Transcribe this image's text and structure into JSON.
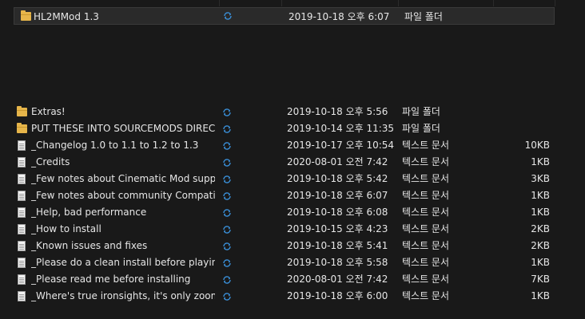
{
  "selected_item": {
    "name": "HL2MMod 1.3",
    "icon": "folder-icon",
    "status_icon": "sync-icon",
    "modified": "2019-10-18 오후 6:07",
    "type": "파일 폴더",
    "size": ""
  },
  "files": [
    {
      "name": "Extras!",
      "icon": "folder-icon",
      "modified": "2019-10-18 오후 5:56",
      "type": "파일 폴더",
      "size": ""
    },
    {
      "name": "PUT THESE INTO SOURCEMODS DIREC...",
      "icon": "folder-icon",
      "modified": "2019-10-14 오후 11:35",
      "type": "파일 폴더",
      "size": ""
    },
    {
      "name": "_Changelog 1.0 to 1.1 to 1.2 to 1.3",
      "icon": "document-icon",
      "modified": "2019-10-17 오후 10:54",
      "type": "텍스트 문서",
      "size": "10KB"
    },
    {
      "name": "_Credits",
      "icon": "document-icon",
      "modified": "2020-08-01 오전 7:42",
      "type": "텍스트 문서",
      "size": "1KB"
    },
    {
      "name": "_Few notes about Cinematic Mod support",
      "icon": "document-icon",
      "modified": "2019-10-18 오후 5:42",
      "type": "텍스트 문서",
      "size": "3KB"
    },
    {
      "name": "_Few notes about community Compatib...",
      "icon": "document-icon",
      "modified": "2019-10-18 오후 6:07",
      "type": "텍스트 문서",
      "size": "1KB"
    },
    {
      "name": "_Help, bad performance",
      "icon": "document-icon",
      "modified": "2019-10-18 오후 6:08",
      "type": "텍스트 문서",
      "size": "1KB"
    },
    {
      "name": "_How to install",
      "icon": "document-icon",
      "modified": "2019-10-15 오후 4:23",
      "type": "텍스트 문서",
      "size": "2KB"
    },
    {
      "name": "_Known issues and fixes",
      "icon": "document-icon",
      "modified": "2019-10-18 오후 5:41",
      "type": "텍스트 문서",
      "size": "2KB"
    },
    {
      "name": "_Please do a clean install before playing",
      "icon": "document-icon",
      "modified": "2019-10-18 오후 5:58",
      "type": "텍스트 문서",
      "size": "1KB"
    },
    {
      "name": "_Please read me before installing",
      "icon": "document-icon",
      "modified": "2020-08-01 오전 7:42",
      "type": "텍스트 문서",
      "size": "7KB"
    },
    {
      "name": "_Where's true ironsights, it's only zoom!",
      "icon": "document-icon",
      "modified": "2019-10-18 오후 6:00",
      "type": "텍스트 문서",
      "size": "1KB"
    }
  ],
  "colors": {
    "background": "#191919",
    "text": "#e6e6e6",
    "folder": "#e6b54a",
    "sync_blue": "#3a8fd8",
    "selection": "#2a2a2a"
  }
}
